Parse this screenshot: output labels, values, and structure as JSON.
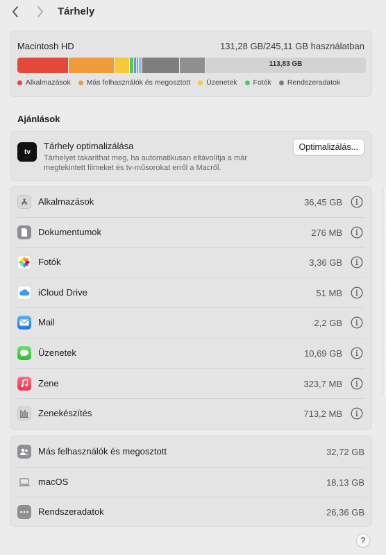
{
  "window": {
    "title": "Tárhely"
  },
  "storage": {
    "disk_name": "Macintosh HD",
    "usage_text": "131,28 GB/245,11 GB használatban",
    "free_label": "113,83 GB",
    "legend": [
      {
        "label": "Alkalmazások",
        "color": "#e4483a"
      },
      {
        "label": "Más felhasználók és megosztott",
        "color": "#ef9a3b"
      },
      {
        "label": "Üzenetek",
        "color": "#f4ca3a"
      },
      {
        "label": "Fotók",
        "color": "#5bc55b"
      },
      {
        "label": "Rendszeradatok",
        "color": "#7e7e7e"
      }
    ]
  },
  "recommendations": {
    "title": "Ajánlások",
    "item": {
      "icon": "apple-tv-icon",
      "icon_text": "tv",
      "title": "Tárhely optimalizálása",
      "description": "Tárhelyet takaríthat meg, ha automatikusan eltávolítja a már megtekintett filmeket és tv-műsorokat erről a Macről.",
      "button": "Optimalizálás..."
    }
  },
  "categories": [
    {
      "label": "Alkalmazások",
      "size": "36,45 GB",
      "icon": "app-store-icon"
    },
    {
      "label": "Dokumentumok",
      "size": "276 MB",
      "icon": "document-icon"
    },
    {
      "label": "Fotók",
      "size": "3,36 GB",
      "icon": "photos-icon"
    },
    {
      "label": "iCloud Drive",
      "size": "51 MB",
      "icon": "icloud-icon"
    },
    {
      "label": "Mail",
      "size": "2,2 GB",
      "icon": "mail-icon"
    },
    {
      "label": "Üzenetek",
      "size": "10,69 GB",
      "icon": "messages-icon"
    },
    {
      "label": "Zene",
      "size": "323,7 MB",
      "icon": "music-icon"
    },
    {
      "label": "Zenekészítés",
      "size": "713,2 MB",
      "icon": "music-creation-icon"
    }
  ],
  "system": [
    {
      "label": "Más felhasználók és megosztott",
      "size": "32,72 GB",
      "icon": "users-icon"
    },
    {
      "label": "macOS",
      "size": "18,13 GB",
      "icon": "laptop-icon"
    },
    {
      "label": "Rendszeradatok",
      "size": "26,36 GB",
      "icon": "more-icon"
    }
  ],
  "help": {
    "label": "?"
  }
}
